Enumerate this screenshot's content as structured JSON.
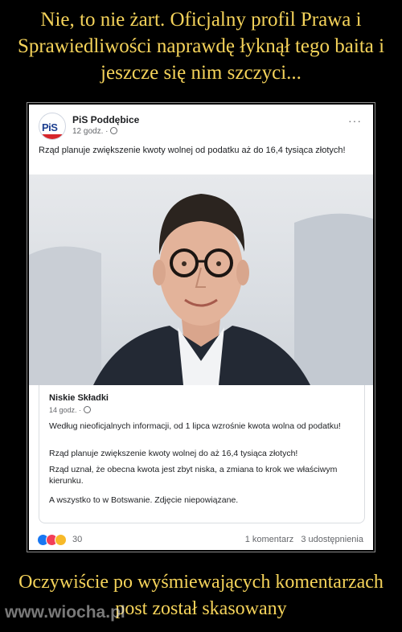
{
  "meme": {
    "top_caption": "Nie, to nie żart. Oficjalny profil Prawa i Sprawiedliwości naprawdę łyknął tego baita i jeszcze się nim szczyci...",
    "bottom_caption": "Oczywiście po wyśmiewających komentarzach post został skasowany",
    "watermark": "www.wiocha.pl"
  },
  "post": {
    "page_name": "PiS Poddębice",
    "avatar_text": "PiS",
    "time": "12 godz. ·",
    "text": "Rząd planuje zwiększenie kwoty wolnej od podatku aż do 16,4 tysiąca złotych!",
    "more": "···"
  },
  "linked_post": {
    "title": "Niskie Składki",
    "time": "14 godz. ·",
    "paragraphs": [
      "Według nieoficjalnych informacji, od 1 lipca wzrośnie kwota wolna od podatku!",
      "Rząd planuje zwiększenie kwoty wolnej do aż 16,4 tysiąca złotych!",
      "Rząd uznał, że obecna kwota jest zbyt niska, a zmiana to krok we właściwym kierunku.",
      "A wszystko to w Botswanie. Zdjęcie niepowiązane."
    ]
  },
  "footer": {
    "reaction_count": "30",
    "comments": "1 komentarz",
    "shares": "3 udostępnienia"
  },
  "colors": {
    "caption": "#f5d35a",
    "facebook_blue": "#1877f2",
    "love_red": "#f33e58",
    "haha_yellow": "#f7b928"
  },
  "icons": [
    "pis-logo-icon",
    "globe-icon",
    "more-options-icon",
    "like-reaction-icon",
    "love-reaction-icon",
    "haha-reaction-icon"
  ]
}
